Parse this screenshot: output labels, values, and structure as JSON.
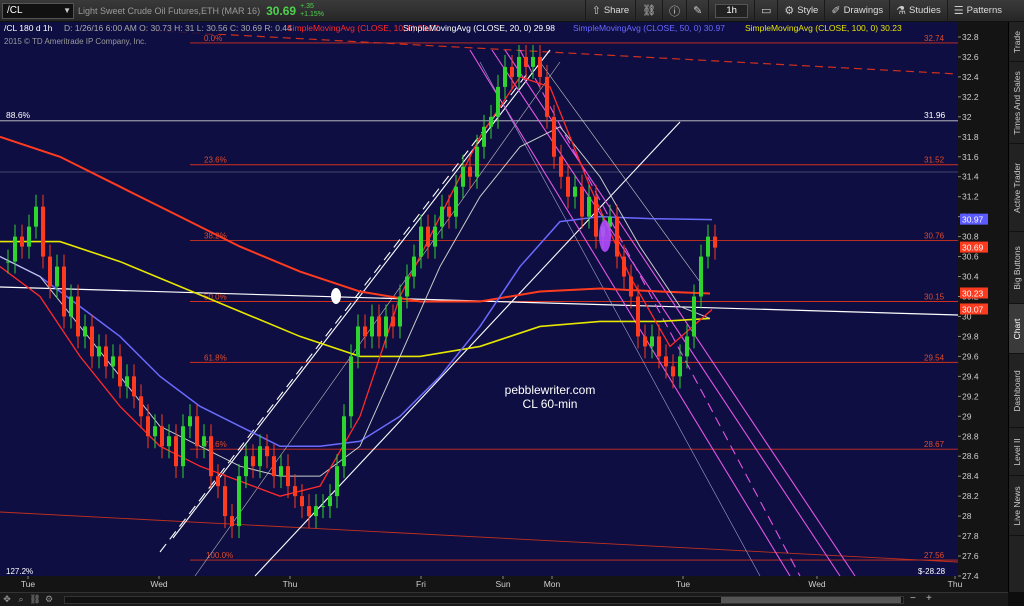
{
  "toolbar": {
    "symbol": "/CL",
    "chart_label": "/CL 180 d 1h",
    "description": "Light Sweet Crude Oil Futures,ETH (MAR 16)",
    "last_price": "30.69",
    "change": "+.35",
    "change_pct": "+1.15%",
    "share": "Share",
    "timeframe": "1h",
    "style": "Style",
    "drawings": "Drawings",
    "studies": "Studies",
    "patterns": "Patterns",
    "icons": {
      "dropdown": "chevron-down-icon",
      "share": "share-icon",
      "link": "link-icon",
      "info": "info-icon",
      "pin": "pin-icon",
      "window": "window-icon",
      "style": "style-icon",
      "drawings": "pencil-icon",
      "studies": "flask-icon",
      "patterns": "patterns-icon"
    }
  },
  "sidebar": {
    "tabs": [
      "Trade",
      "Times And Sales",
      "Active Trader",
      "Big Buttons",
      "Chart",
      "Dashboard",
      "Level II",
      "Live News"
    ],
    "active": "Chart"
  },
  "bottom_bar": {
    "zoom_out": "−",
    "zoom_in": "+",
    "icons": [
      "pan-icon",
      "zoom-icon",
      "link-icon",
      "settings-icon"
    ]
  },
  "chart_data": {
    "type": "candlestick",
    "ohlc_label": "D: 1/26/16 6:00 AM O: 30.73 H: 31 L: 30.56 C: 30.69 R: 0.44",
    "copyright": "2015 © TD Ameritrade IP Company, Inc.",
    "studies": [
      {
        "label": "SimpleMovingAvg (CLOSE, 10, 0)",
        "value": "30.07",
        "color": "#ff2a2a"
      },
      {
        "label": "SimpleMovingAvg (CLOSE, 20, 0)",
        "value": "29.98",
        "color": "#ffffff"
      },
      {
        "label": "SimpleMovingAvg (CLOSE, 50, 0)",
        "value": "30.97",
        "color": "#6a6aff"
      },
      {
        "label": "SimpleMovingAvg (CLOSE, 100, 0)",
        "value": "30.23",
        "color": "#e6e600"
      }
    ],
    "x_ticks": [
      "Tue",
      "Wed",
      "Thu",
      "Fri",
      "Sun",
      "Mon",
      "Tue",
      "Wed",
      "Thu"
    ],
    "y_ticks": [
      27.4,
      27.6,
      27.8,
      28,
      28.2,
      28.4,
      28.6,
      28.8,
      29,
      29.2,
      29.4,
      29.6,
      29.8,
      30,
      30.2,
      30.4,
      30.6,
      30.8,
      31,
      31.2,
      31.4,
      31.6,
      31.8,
      32,
      32.2,
      32.4,
      32.6,
      32.8
    ],
    "ylim": [
      27.4,
      32.95
    ],
    "fib_levels": [
      {
        "label": "0.0%",
        "value": 32.74
      },
      {
        "label": "23.6%",
        "value": 31.52
      },
      {
        "label": "38.2%",
        "value": 30.76
      },
      {
        "label": "50.0%",
        "value": 30.15
      },
      {
        "label": "61.8%",
        "value": 29.54
      },
      {
        "label": "78.6%",
        "value": 28.67
      },
      {
        "label": "100.0%",
        "value": 27.56
      }
    ],
    "fib_value_labels": [
      "32.74",
      "31.52",
      "30.76",
      "30.15",
      "29.54",
      "28.67",
      "27.56"
    ],
    "level_88": {
      "label": "88.6%",
      "value": 31.96,
      "value_label": "31.96"
    },
    "left_label_127": "127.2%",
    "bottom_right_label": "$-28.28",
    "price_tags": [
      {
        "text": "30.97",
        "value": 30.97,
        "color": "#5a5aff"
      },
      {
        "text": "30.69",
        "value": 30.69,
        "color": "#ff3b1f"
      },
      {
        "text": "30.23",
        "value": 30.23,
        "color": "#ff3b1f"
      },
      {
        "text": "30.07",
        "value": 30.07,
        "color": "#ff3b1f"
      }
    ],
    "annotation": [
      "pebblewriter.com",
      "CL 60-min"
    ],
    "closes": [
      30.55,
      30.8,
      30.7,
      30.9,
      31.1,
      30.6,
      30.3,
      30.5,
      30.0,
      30.2,
      29.8,
      29.9,
      29.6,
      29.7,
      29.5,
      29.6,
      29.3,
      29.4,
      29.2,
      29.0,
      28.8,
      28.9,
      28.7,
      28.8,
      28.5,
      28.9,
      29.0,
      28.7,
      28.8,
      28.4,
      28.3,
      28.0,
      27.9,
      28.4,
      28.6,
      28.5,
      28.7,
      28.6,
      28.4,
      28.5,
      28.3,
      28.2,
      28.1,
      28.0,
      28.1,
      28.1,
      28.2,
      28.5,
      29.0,
      29.6,
      29.9,
      29.8,
      30.0,
      29.8,
      30.0,
      29.9,
      30.2,
      30.4,
      30.6,
      30.9,
      30.7,
      30.9,
      31.1,
      31.0,
      31.3,
      31.5,
      31.4,
      31.7,
      31.9,
      32.0,
      32.3,
      32.5,
      32.4,
      32.6,
      32.5,
      32.6,
      32.4,
      32.0,
      31.6,
      31.4,
      31.2,
      31.3,
      31.0,
      31.2,
      30.8,
      30.9,
      31.0,
      30.6,
      30.4,
      30.2,
      29.8,
      29.7,
      29.8,
      29.6,
      29.5,
      29.4,
      29.6,
      29.8,
      30.2,
      30.6,
      30.8,
      30.69
    ]
  }
}
